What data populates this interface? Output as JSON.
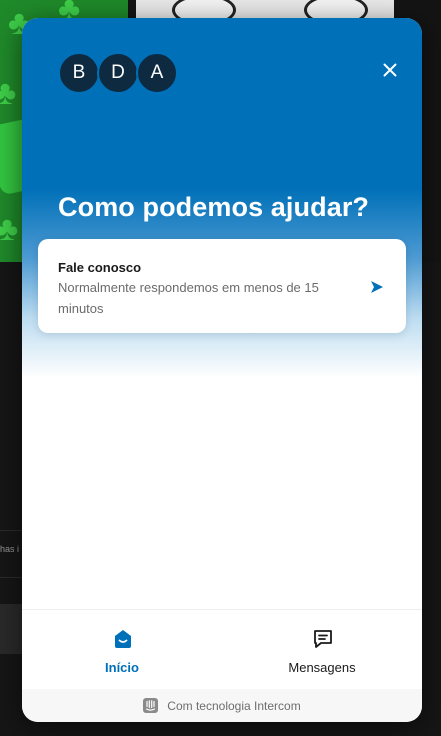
{
  "background": {
    "fragment_text": "has i"
  },
  "messenger": {
    "team_avatars": [
      {
        "initial": "B"
      },
      {
        "initial": "D"
      },
      {
        "initial": "A"
      }
    ],
    "close_icon": "close-icon",
    "heading": "Como podemos ajudar?",
    "contact_card": {
      "title": "Fale conosco",
      "subtitle": "Normalmente respondemos em menos de 15 minutos",
      "icon": "send-arrow-icon"
    },
    "nav": {
      "home_label": "Início",
      "home_icon": "home-icon",
      "messages_label": "Mensagens",
      "messages_icon": "chat-bubble-icon"
    },
    "footer": {
      "powered_by": "Com tecnologia Intercom",
      "icon": "intercom-logo-icon"
    },
    "colors": {
      "primary": "#0070b8",
      "avatar_bg": "#0d2a40",
      "text_dark": "#1a1a1a",
      "text_muted": "#6b6b6b"
    }
  }
}
